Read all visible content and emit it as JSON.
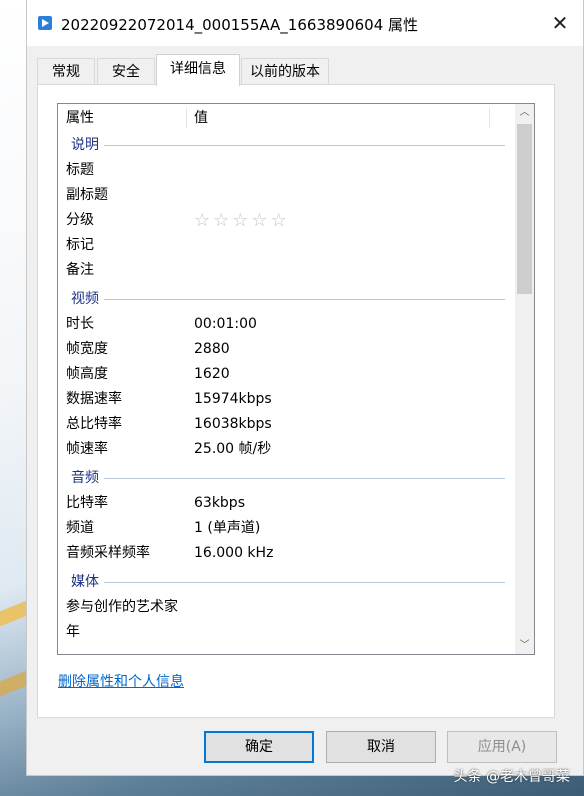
{
  "window": {
    "title": "20220922072014_000155AA_1663890604 属性"
  },
  "tabs": [
    {
      "label": "常规"
    },
    {
      "label": "安全"
    },
    {
      "label": "详细信息"
    },
    {
      "label": "以前的版本"
    }
  ],
  "list": {
    "header": {
      "property": "属性",
      "value": "值"
    },
    "groups": {
      "description": {
        "label": "说明",
        "rows": [
          {
            "key": "标题",
            "value": ""
          },
          {
            "key": "副标题",
            "value": ""
          },
          {
            "key": "分级",
            "value": ""
          },
          {
            "key": "标记",
            "value": ""
          },
          {
            "key": "备注",
            "value": ""
          }
        ],
        "rating_stars": 0,
        "rating_max": 5
      },
      "video": {
        "label": "视频",
        "rows": [
          {
            "key": "时长",
            "value": "00:01:00"
          },
          {
            "key": "帧宽度",
            "value": "2880"
          },
          {
            "key": "帧高度",
            "value": "1620"
          },
          {
            "key": "数据速率",
            "value": "15974kbps"
          },
          {
            "key": "总比特率",
            "value": "16038kbps"
          },
          {
            "key": "帧速率",
            "value": "25.00 帧/秒"
          }
        ]
      },
      "audio": {
        "label": "音频",
        "rows": [
          {
            "key": "比特率",
            "value": "63kbps"
          },
          {
            "key": "频道",
            "value": "1 (单声道)"
          },
          {
            "key": "音频采样频率",
            "value": "16.000 kHz"
          }
        ]
      },
      "media": {
        "label": "媒体",
        "rows": [
          {
            "key": "参与创作的艺术家",
            "value": ""
          },
          {
            "key": "年",
            "value": ""
          }
        ]
      }
    }
  },
  "remove_link": "删除属性和个人信息",
  "buttons": {
    "ok": "确定",
    "cancel": "取消",
    "apply": "应用(A)"
  },
  "watermark": "头条 @老木曾哥菜",
  "colors": {
    "accent": "#0078d7",
    "group_label": "#1e3287",
    "link": "#0066cc"
  }
}
